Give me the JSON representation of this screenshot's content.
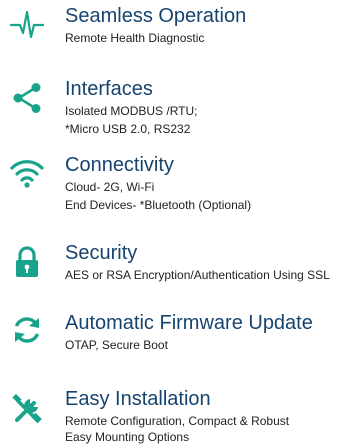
{
  "accent_color": "#19a38b",
  "title_color": "#17446f",
  "features": [
    {
      "icon": "heartbeat-icon",
      "title": "Seamless Operation",
      "lines": [
        "Remote Health Diagnostic"
      ]
    },
    {
      "icon": "share-icon",
      "title": "Interfaces",
      "lines": [
        "Isolated MODBUS /RTU;",
        "*Micro USB 2.0, RS232"
      ]
    },
    {
      "icon": "wifi-icon",
      "title": "Connectivity",
      "lines": [
        "Cloud- 2G, Wi-Fi",
        "End Devices- *Bluetooth (Optional)"
      ]
    },
    {
      "icon": "lock-icon",
      "title": "Security",
      "lines": [
        "AES or RSA Encryption/Authentication Using SSL"
      ]
    },
    {
      "icon": "refresh-icon",
      "title": "Automatic Firmware Update",
      "lines": [
        "OTAP, Secure Boot"
      ]
    },
    {
      "icon": "tools-icon",
      "title": "Easy Installation",
      "lines": [
        "Remote Configuration, Compact & Robust",
        "Easy Mounting Options"
      ]
    }
  ]
}
